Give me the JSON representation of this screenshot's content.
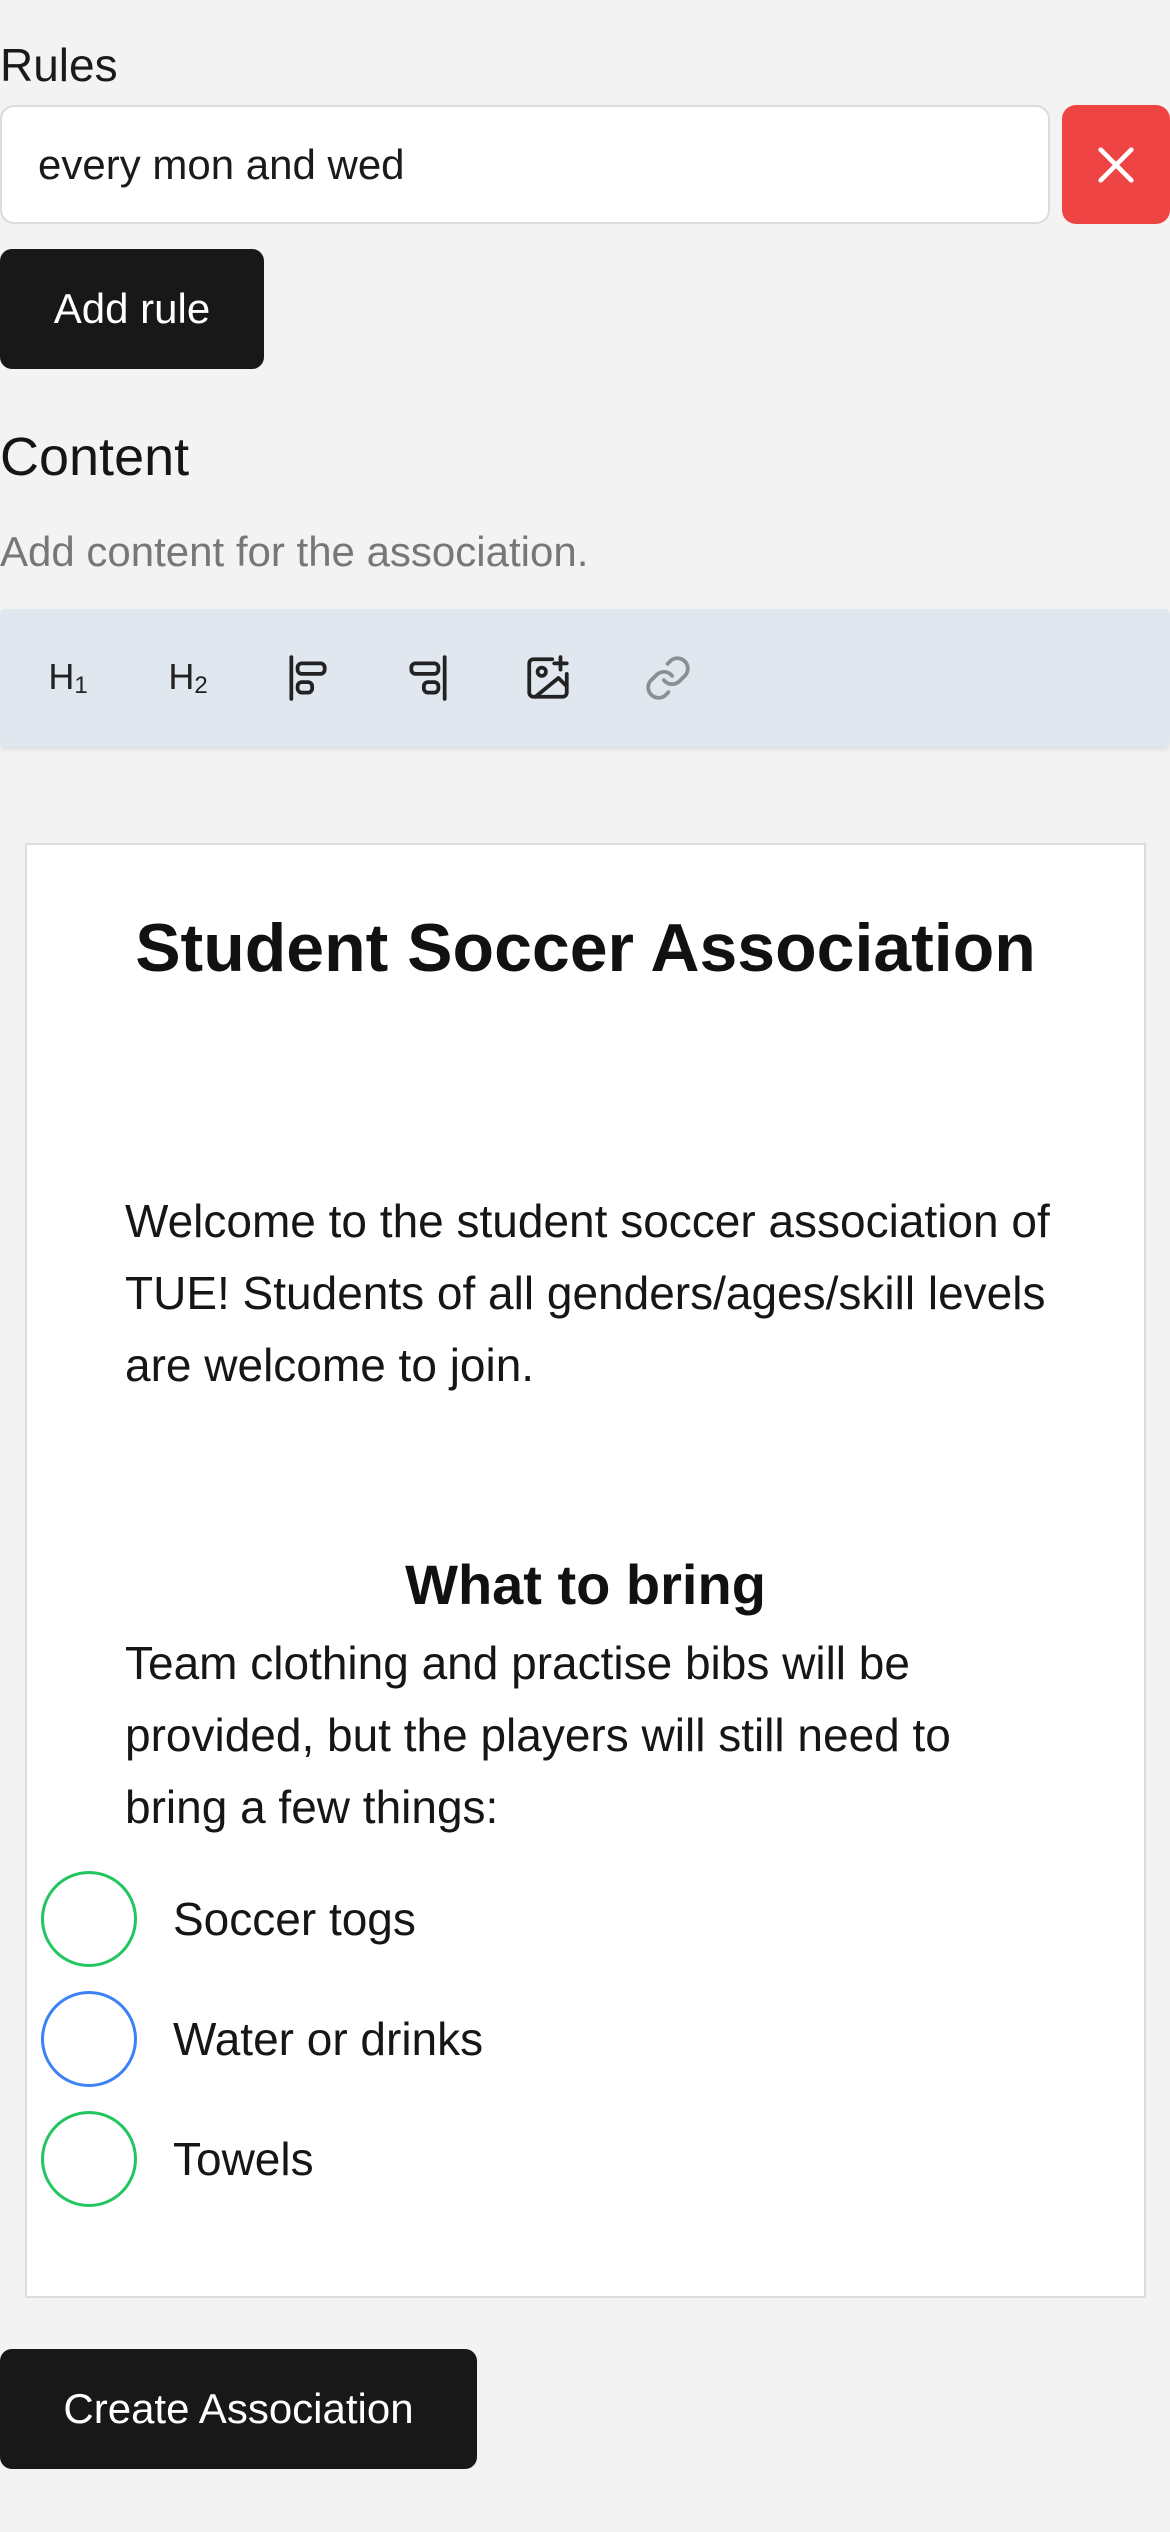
{
  "rules": {
    "label": "Rules",
    "items": [
      {
        "value": "every mon and wed"
      }
    ],
    "add_label": "Add rule",
    "delete_icon": "close-icon",
    "delete_color": "#ef4444"
  },
  "content": {
    "heading": "Content",
    "description": "Add content for the association."
  },
  "toolbar": {
    "h1": {
      "letter": "H",
      "sub": "1"
    },
    "h2": {
      "letter": "H",
      "sub": "2"
    },
    "icons": [
      "align-left-icon",
      "align-right-icon",
      "image-plus-icon",
      "link-icon"
    ]
  },
  "document": {
    "title": "Student Soccer Association",
    "intro": "Welcome to the student soccer association of TUE! Students of all genders/ages/skill levels are welcome to join.",
    "subheading": "What to bring",
    "body": "Team clothing and practise bibs will be provided, but the players will still need to bring a few things:",
    "checklist": [
      {
        "label": "Soccer togs",
        "color": "#22c55e"
      },
      {
        "label": "Water or drinks",
        "color": "#3b82f6"
      },
      {
        "label": "Towels",
        "color": "#22c55e"
      }
    ]
  },
  "footer": {
    "create_label": "Create Association"
  }
}
